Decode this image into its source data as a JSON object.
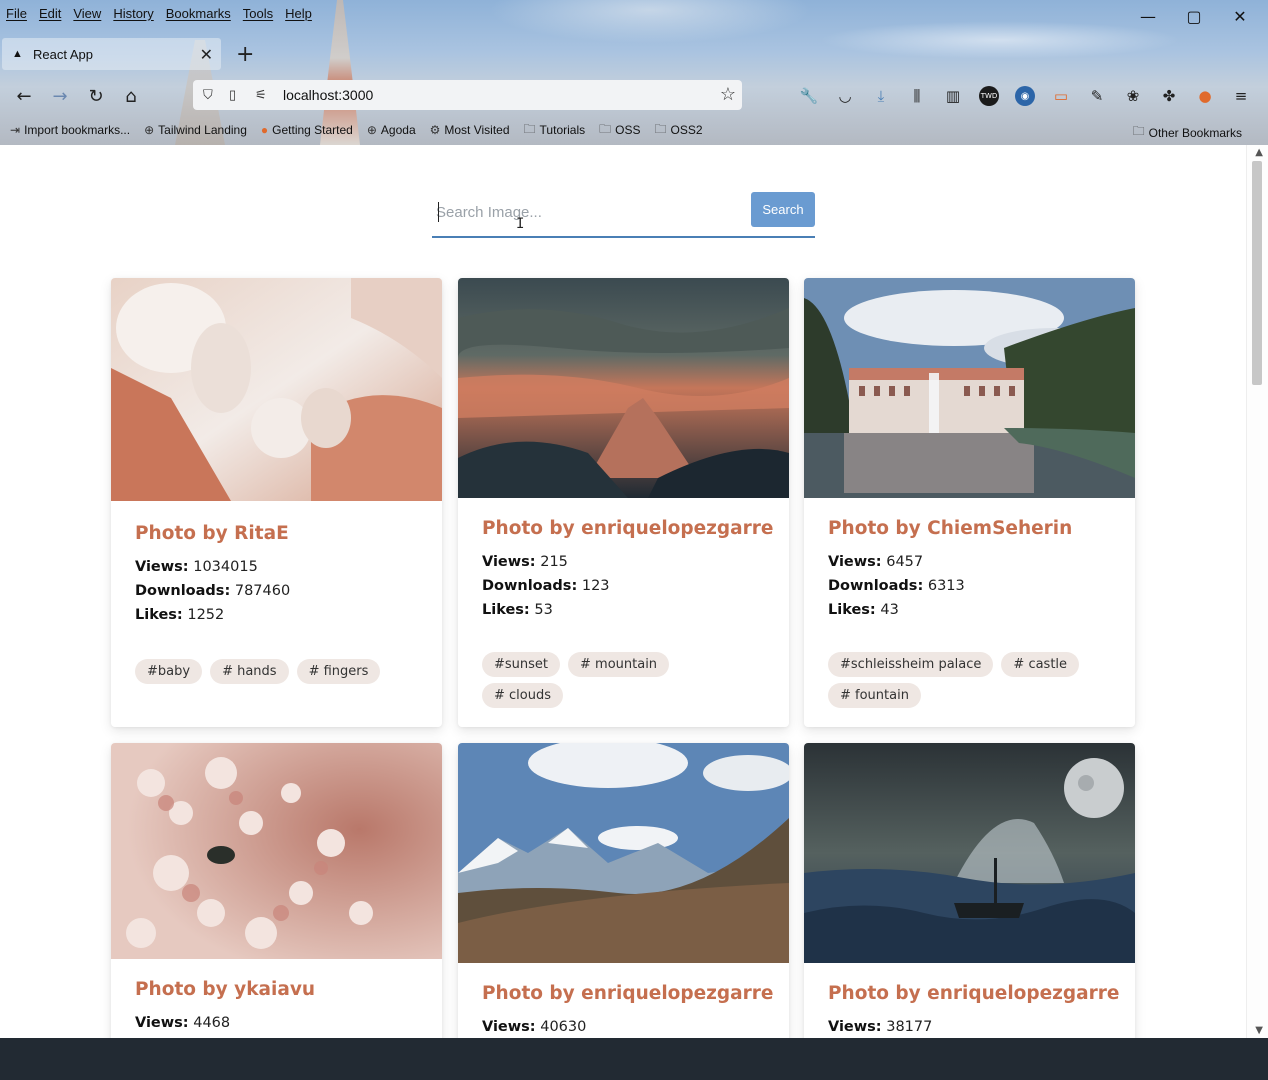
{
  "menu": [
    "File",
    "Edit",
    "View",
    "History",
    "Bookmarks",
    "Tools",
    "Help"
  ],
  "tab": {
    "title": "React App",
    "close": "✕",
    "new_tab": "+"
  },
  "address": {
    "url": "localhost:3000"
  },
  "bookmarks": [
    {
      "label": "Import bookmarks...",
      "icon": "import-icon"
    },
    {
      "label": "Tailwind Landing",
      "icon": "globe-icon"
    },
    {
      "label": "Getting Started",
      "icon": "firefox-icon"
    },
    {
      "label": "Agoda",
      "icon": "globe-icon"
    },
    {
      "label": "Most Visited",
      "icon": "gear-icon"
    },
    {
      "label": "Tutorials",
      "icon": "folder-icon"
    },
    {
      "label": "OSS",
      "icon": "folder-icon"
    },
    {
      "label": "OSS2",
      "icon": "folder-icon"
    }
  ],
  "other_bookmarks": "Other Bookmarks",
  "search": {
    "placeholder": "Search Image...",
    "button": "Search"
  },
  "labels": {
    "views": "Views:",
    "downloads": "Downloads:",
    "likes": "Likes:"
  },
  "cards": [
    {
      "title": "Photo by RitaE",
      "views": "1034015",
      "downloads": "787460",
      "likes": "1252",
      "tags": [
        "#baby",
        "# hands",
        "# fingers"
      ]
    },
    {
      "title": "Photo by enriquelopezgarre",
      "views": "215",
      "downloads": "123",
      "likes": "53",
      "tags": [
        "#sunset",
        "# mountain",
        "# clouds"
      ]
    },
    {
      "title": "Photo by ChiemSeherin",
      "views": "6457",
      "downloads": "6313",
      "likes": "43",
      "tags": [
        "#schleissheim palace",
        "# castle",
        "# fountain"
      ]
    },
    {
      "title": "Photo by ykaiavu",
      "views": "4468"
    },
    {
      "title": "Photo by enriquelopezgarre",
      "views": "40630"
    },
    {
      "title": "Photo by enriquelopezgarre",
      "views": "38177"
    }
  ],
  "colors": {
    "title": "#c56f4f",
    "button": "#6a9bd1",
    "tag_bg": "#efe7e3"
  }
}
